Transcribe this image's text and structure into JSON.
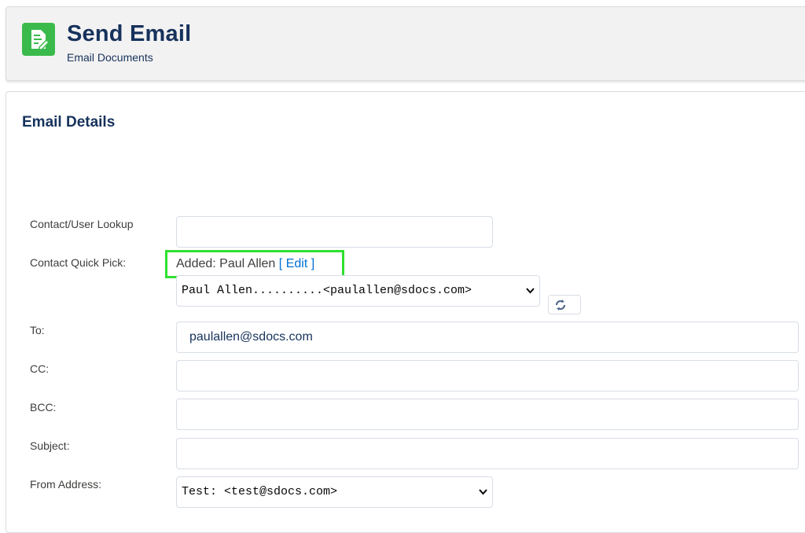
{
  "header": {
    "title": "Send Email",
    "subtitle": "Email Documents",
    "icon": "document-edit-icon",
    "icon_color": "#3bba4c"
  },
  "section": {
    "title": "Email Details"
  },
  "form": {
    "lookup_label": "Contact/User Lookup",
    "lookup_value": "",
    "quick_pick_label": "Contact Quick Pick:",
    "added_prefix": "Added: Paul Allen",
    "edit_open": "[",
    "edit_label": "Edit",
    "edit_close": "]",
    "quick_pick_selected": "Paul Allen..........<paulallen@sdocs.com>",
    "to_label": "To:",
    "to_value": "paulallen@sdocs.com",
    "cc_label": "CC:",
    "cc_value": "",
    "bcc_label": "BCC:",
    "bcc_value": "",
    "subject_label": "Subject:",
    "subject_value": "",
    "from_label": "From Address:",
    "from_selected": "Test: <test@sdocs.com>"
  },
  "colors": {
    "title": "#16325c",
    "highlight": "#2fe02f",
    "link": "#0070d2"
  }
}
